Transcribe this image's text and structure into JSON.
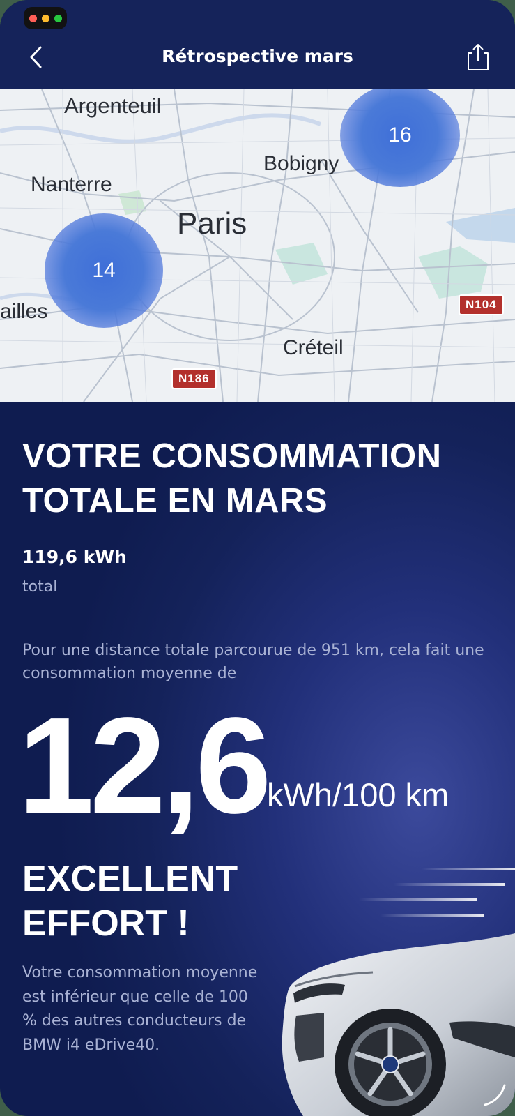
{
  "header": {
    "title": "Rétrospective mars",
    "back_icon": "chevron-left-icon",
    "share_icon": "share-icon"
  },
  "window_controls": {
    "colors": [
      "#ff5f57",
      "#febc2e",
      "#28c840"
    ]
  },
  "map": {
    "places": [
      "Argenteuil",
      "Bobigny",
      "Nanterre",
      "Paris",
      "ailles",
      "Créteil"
    ],
    "road_badges": [
      "N104",
      "N186"
    ],
    "clusters": [
      {
        "label": "16"
      },
      {
        "label": "14"
      }
    ]
  },
  "summary": {
    "heading_line1": "VOTRE CONSOMMATION",
    "heading_line2": "TOTALE EN MARS",
    "total_value": "119,6 kWh",
    "total_label": "total",
    "intro_text": "Pour une distance totale parcourue de 951 km, cela fait une consommation moyenne de",
    "average_value": "12,6",
    "average_unit": "kWh/100 km",
    "verdict_line1": "EXCELLENT",
    "verdict_line2": "EFFORT !",
    "comparison_text": "Votre consommation moyenne est inférieur que celle de 100 % des autres conducteurs de BMW i4 eDrive40."
  },
  "colors": {
    "background": "#14225a",
    "header": "#15235a",
    "accent_cluster": "#3f6fd8",
    "secondary_text": "#a9b2d4",
    "road_badge": "#b3302c"
  }
}
